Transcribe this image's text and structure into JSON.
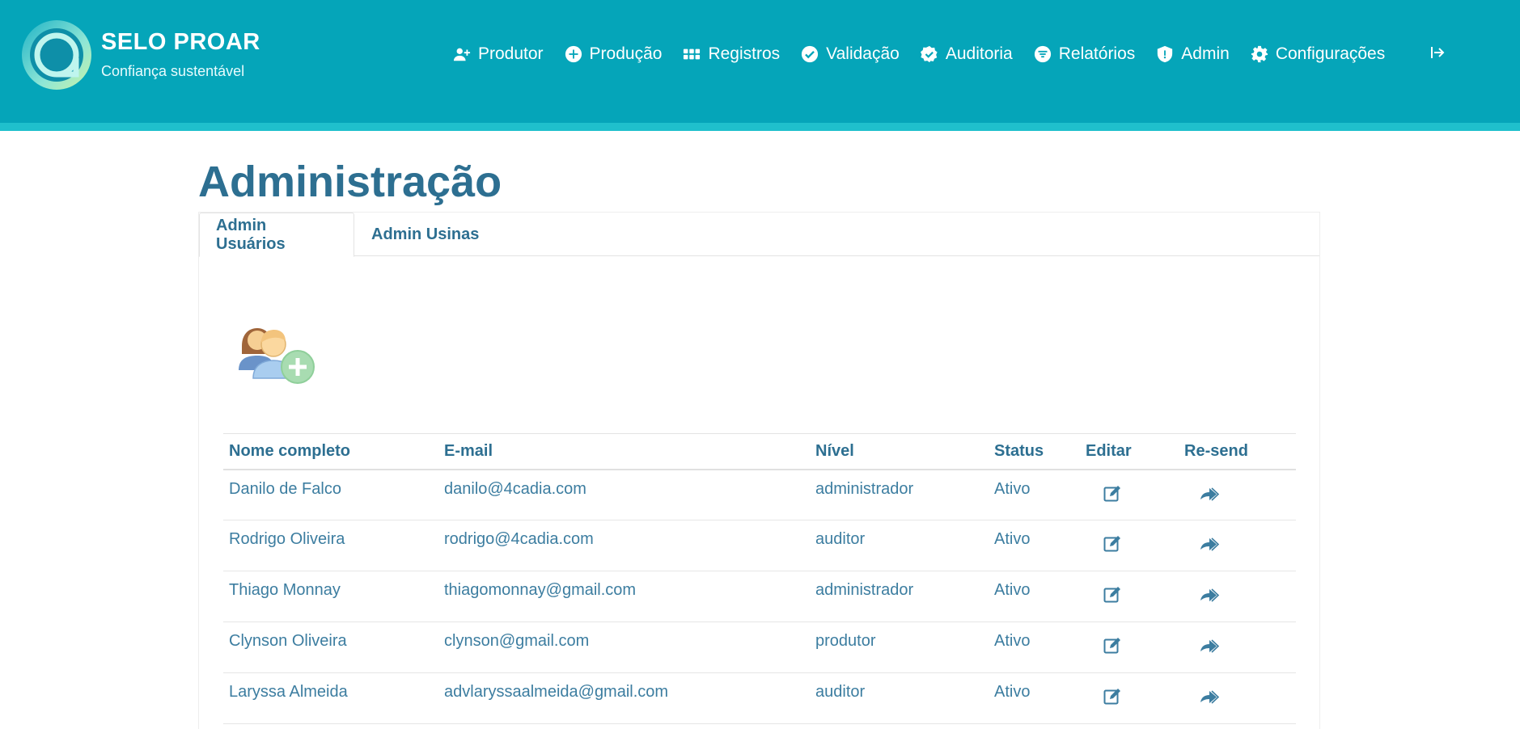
{
  "brand": {
    "title": "SELO PROAR",
    "subtitle": "Confiança sustentável"
  },
  "nav": {
    "items": [
      {
        "label": "Produtor",
        "icon": "user-plus-icon"
      },
      {
        "label": "Produção",
        "icon": "plus-circle-icon"
      },
      {
        "label": "Registros",
        "icon": "grid-icon"
      },
      {
        "label": "Validação",
        "icon": "check-circle-icon"
      },
      {
        "label": "Auditoria",
        "icon": "badge-check-icon"
      },
      {
        "label": "Relatórios",
        "icon": "filter-circle-icon"
      },
      {
        "label": "Admin",
        "icon": "shield-icon"
      },
      {
        "label": "Configurações",
        "icon": "gear-icon"
      }
    ],
    "logout_icon": "logout-icon"
  },
  "page": {
    "title": "Administração"
  },
  "tabs": [
    {
      "label": "Admin Usuários",
      "active": true
    },
    {
      "label": "Admin Usinas",
      "active": false
    }
  ],
  "table": {
    "headers": [
      "Nome completo",
      "E-mail",
      "Nível",
      "Status",
      "Editar",
      "Re-send"
    ],
    "rows": [
      {
        "name": "Danilo de Falco",
        "email": "danilo@4cadia.com",
        "level": "administrador",
        "status": "Ativo"
      },
      {
        "name": "Rodrigo Oliveira",
        "email": "rodrigo@4cadia.com",
        "level": "auditor",
        "status": "Ativo"
      },
      {
        "name": "Thiago Monnay",
        "email": "thiagomonnay@gmail.com",
        "level": "administrador",
        "status": "Ativo"
      },
      {
        "name": "Clynson Oliveira",
        "email": "clynson@gmail.com",
        "level": "produtor",
        "status": "Ativo"
      },
      {
        "name": "Laryssa Almeida",
        "email": "advlaryssaalmeida@gmail.com",
        "level": "auditor",
        "status": "Ativo"
      }
    ]
  },
  "colors": {
    "header": "#05a5b9",
    "accent_stripe": "#1fc0cc",
    "text": "#2d6f91"
  }
}
